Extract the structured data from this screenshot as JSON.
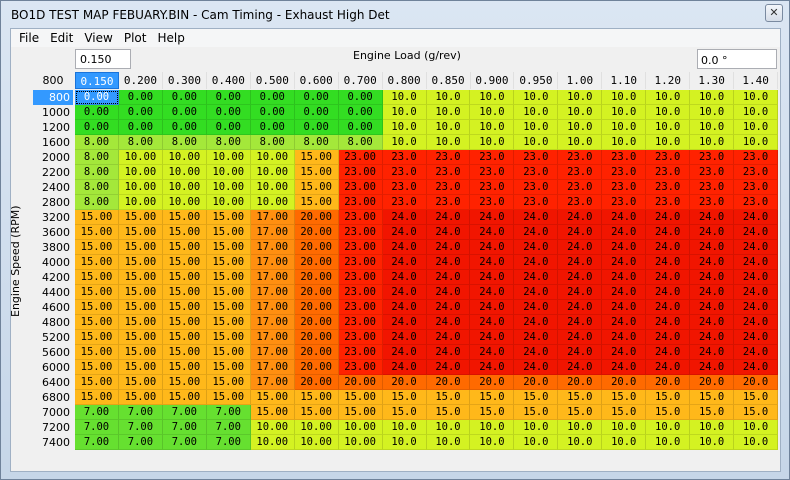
{
  "window": {
    "title": "BO1D TEST MAP FEBUARY.BIN - Cam Timing - Exhaust High Det",
    "close_glyph": "✕"
  },
  "menu": [
    "File",
    "Edit",
    "View",
    "Plot",
    "Help"
  ],
  "toolbar": {
    "load_value": "0.150",
    "x_axis_label": "Engine Load (g/rev)",
    "angle_value": "0.0 °"
  },
  "corner_value": "800",
  "y_axis_label": "Engine Speed (RPM)",
  "columns": [
    "0.150",
    "0.200",
    "0.300",
    "0.400",
    "0.500",
    "0.600",
    "0.700",
    "0.800",
    "0.850",
    "0.900",
    "0.950",
    "1.00",
    "1.10",
    "1.20",
    "1.30",
    "1.40"
  ],
  "rows": [
    {
      "rpm": "800",
      "v": [
        "0.00",
        "0.00",
        "0.00",
        "0.00",
        "0.00",
        "0.00",
        "0.00",
        "10.0",
        "10.0",
        "10.0",
        "10.0",
        "10.0",
        "10.0",
        "10.0",
        "10.0",
        "10.0"
      ]
    },
    {
      "rpm": "1000",
      "v": [
        "0.00",
        "0.00",
        "0.00",
        "0.00",
        "0.00",
        "0.00",
        "0.00",
        "10.0",
        "10.0",
        "10.0",
        "10.0",
        "10.0",
        "10.0",
        "10.0",
        "10.0",
        "10.0"
      ]
    },
    {
      "rpm": "1200",
      "v": [
        "0.00",
        "0.00",
        "0.00",
        "0.00",
        "0.00",
        "0.00",
        "0.00",
        "10.0",
        "10.0",
        "10.0",
        "10.0",
        "10.0",
        "10.0",
        "10.0",
        "10.0",
        "10.0"
      ]
    },
    {
      "rpm": "1600",
      "v": [
        "8.00",
        "8.00",
        "8.00",
        "8.00",
        "8.00",
        "8.00",
        "8.00",
        "10.0",
        "10.0",
        "10.0",
        "10.0",
        "10.0",
        "10.0",
        "10.0",
        "10.0",
        "10.0"
      ]
    },
    {
      "rpm": "2000",
      "v": [
        "8.00",
        "10.00",
        "10.00",
        "10.00",
        "10.00",
        "15.00",
        "23.00",
        "23.0",
        "23.0",
        "23.0",
        "23.0",
        "23.0",
        "23.0",
        "23.0",
        "23.0",
        "23.0"
      ]
    },
    {
      "rpm": "2200",
      "v": [
        "8.00",
        "10.00",
        "10.00",
        "10.00",
        "10.00",
        "15.00",
        "23.00",
        "23.0",
        "23.0",
        "23.0",
        "23.0",
        "23.0",
        "23.0",
        "23.0",
        "23.0",
        "23.0"
      ]
    },
    {
      "rpm": "2400",
      "v": [
        "8.00",
        "10.00",
        "10.00",
        "10.00",
        "10.00",
        "15.00",
        "23.00",
        "23.0",
        "23.0",
        "23.0",
        "23.0",
        "23.0",
        "23.0",
        "23.0",
        "23.0",
        "23.0"
      ]
    },
    {
      "rpm": "2800",
      "v": [
        "8.00",
        "10.00",
        "10.00",
        "10.00",
        "10.00",
        "15.00",
        "23.00",
        "23.0",
        "23.0",
        "23.0",
        "23.0",
        "23.0",
        "23.0",
        "23.0",
        "23.0",
        "23.0"
      ]
    },
    {
      "rpm": "3200",
      "v": [
        "15.00",
        "15.00",
        "15.00",
        "15.00",
        "17.00",
        "20.00",
        "23.00",
        "24.0",
        "24.0",
        "24.0",
        "24.0",
        "24.0",
        "24.0",
        "24.0",
        "24.0",
        "24.0"
      ]
    },
    {
      "rpm": "3600",
      "v": [
        "15.00",
        "15.00",
        "15.00",
        "15.00",
        "17.00",
        "20.00",
        "23.00",
        "24.0",
        "24.0",
        "24.0",
        "24.0",
        "24.0",
        "24.0",
        "24.0",
        "24.0",
        "24.0"
      ]
    },
    {
      "rpm": "3800",
      "v": [
        "15.00",
        "15.00",
        "15.00",
        "15.00",
        "17.00",
        "20.00",
        "23.00",
        "24.0",
        "24.0",
        "24.0",
        "24.0",
        "24.0",
        "24.0",
        "24.0",
        "24.0",
        "24.0"
      ]
    },
    {
      "rpm": "4000",
      "v": [
        "15.00",
        "15.00",
        "15.00",
        "15.00",
        "17.00",
        "20.00",
        "23.00",
        "24.0",
        "24.0",
        "24.0",
        "24.0",
        "24.0",
        "24.0",
        "24.0",
        "24.0",
        "24.0"
      ]
    },
    {
      "rpm": "4200",
      "v": [
        "15.00",
        "15.00",
        "15.00",
        "15.00",
        "17.00",
        "20.00",
        "23.00",
        "24.0",
        "24.0",
        "24.0",
        "24.0",
        "24.0",
        "24.0",
        "24.0",
        "24.0",
        "24.0"
      ]
    },
    {
      "rpm": "4400",
      "v": [
        "15.00",
        "15.00",
        "15.00",
        "15.00",
        "17.00",
        "20.00",
        "23.00",
        "24.0",
        "24.0",
        "24.0",
        "24.0",
        "24.0",
        "24.0",
        "24.0",
        "24.0",
        "24.0"
      ]
    },
    {
      "rpm": "4600",
      "v": [
        "15.00",
        "15.00",
        "15.00",
        "15.00",
        "17.00",
        "20.00",
        "23.00",
        "24.0",
        "24.0",
        "24.0",
        "24.0",
        "24.0",
        "24.0",
        "24.0",
        "24.0",
        "24.0"
      ]
    },
    {
      "rpm": "4800",
      "v": [
        "15.00",
        "15.00",
        "15.00",
        "15.00",
        "17.00",
        "20.00",
        "23.00",
        "24.0",
        "24.0",
        "24.0",
        "24.0",
        "24.0",
        "24.0",
        "24.0",
        "24.0",
        "24.0"
      ]
    },
    {
      "rpm": "5200",
      "v": [
        "15.00",
        "15.00",
        "15.00",
        "15.00",
        "17.00",
        "20.00",
        "23.00",
        "24.0",
        "24.0",
        "24.0",
        "24.0",
        "24.0",
        "24.0",
        "24.0",
        "24.0",
        "24.0"
      ]
    },
    {
      "rpm": "5600",
      "v": [
        "15.00",
        "15.00",
        "15.00",
        "15.00",
        "17.00",
        "20.00",
        "23.00",
        "24.0",
        "24.0",
        "24.0",
        "24.0",
        "24.0",
        "24.0",
        "24.0",
        "24.0",
        "24.0"
      ]
    },
    {
      "rpm": "6000",
      "v": [
        "15.00",
        "15.00",
        "15.00",
        "15.00",
        "17.00",
        "20.00",
        "23.00",
        "24.0",
        "24.0",
        "24.0",
        "24.0",
        "24.0",
        "24.0",
        "24.0",
        "24.0",
        "24.0"
      ]
    },
    {
      "rpm": "6400",
      "v": [
        "15.00",
        "15.00",
        "15.00",
        "15.00",
        "17.00",
        "20.00",
        "20.00",
        "20.0",
        "20.0",
        "20.0",
        "20.0",
        "20.0",
        "20.0",
        "20.0",
        "20.0",
        "20.0"
      ]
    },
    {
      "rpm": "6800",
      "v": [
        "15.00",
        "15.00",
        "15.00",
        "15.00",
        "15.00",
        "15.00",
        "15.00",
        "15.0",
        "15.0",
        "15.0",
        "15.0",
        "15.0",
        "15.0",
        "15.0",
        "15.0",
        "15.0"
      ]
    },
    {
      "rpm": "7000",
      "v": [
        "7.00",
        "7.00",
        "7.00",
        "7.00",
        "15.00",
        "15.00",
        "15.00",
        "15.0",
        "15.0",
        "15.0",
        "15.0",
        "15.0",
        "15.0",
        "15.0",
        "15.0",
        "15.0"
      ]
    },
    {
      "rpm": "7200",
      "v": [
        "7.00",
        "7.00",
        "7.00",
        "7.00",
        "10.00",
        "10.00",
        "10.00",
        "10.0",
        "10.0",
        "10.0",
        "10.0",
        "10.0",
        "10.0",
        "10.0",
        "10.0",
        "10.0"
      ]
    },
    {
      "rpm": "7400",
      "v": [
        "7.00",
        "7.00",
        "7.00",
        "7.00",
        "10.00",
        "10.00",
        "10.00",
        "10.0",
        "10.0",
        "10.0",
        "10.0",
        "10.0",
        "10.0",
        "10.0",
        "10.0",
        "10.0"
      ]
    }
  ],
  "colors": {
    "0": "#33dd22",
    "7": "#66e030",
    "8": "#a4e83a",
    "10": "#d4f222",
    "15": "#ffb81a",
    "17": "#ff8f10",
    "20": "#ff6a00",
    "23": "#ff2200",
    "24": "#f11500",
    "selected": "#3399ff"
  }
}
